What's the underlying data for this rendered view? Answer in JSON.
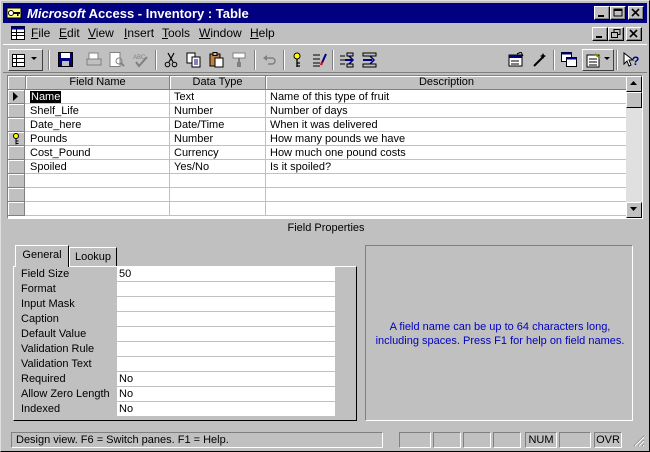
{
  "window": {
    "title_brand": "Microsoft",
    "title_rest": " Access - Inventory : Table"
  },
  "menu": {
    "items": [
      {
        "label": "File",
        "accel": "F"
      },
      {
        "label": "Edit",
        "accel": "E"
      },
      {
        "label": "View",
        "accel": "V"
      },
      {
        "label": "Insert",
        "accel": "I"
      },
      {
        "label": "Tools",
        "accel": "T"
      },
      {
        "label": "Window",
        "accel": "W"
      },
      {
        "label": "Help",
        "accel": "H"
      }
    ]
  },
  "grid": {
    "headers": {
      "field_name": "Field Name",
      "data_type": "Data Type",
      "description": "Description"
    },
    "rows": [
      {
        "field_name": "Name",
        "data_type": "Text",
        "description": "Name of this type of fruit",
        "current": true,
        "key": false
      },
      {
        "field_name": "Shelf_Life",
        "data_type": "Number",
        "description": "Number of days",
        "current": false,
        "key": false
      },
      {
        "field_name": "Date_here",
        "data_type": "Date/Time",
        "description": "When it was delivered",
        "current": false,
        "key": false
      },
      {
        "field_name": "Pounds",
        "data_type": "Number",
        "description": "How many pounds we have",
        "current": false,
        "key": true
      },
      {
        "field_name": "Cost_Pound",
        "data_type": "Currency",
        "description": "How much one pound costs",
        "current": false,
        "key": false
      },
      {
        "field_name": "Spoiled",
        "data_type": "Yes/No",
        "description": "Is it spoiled?",
        "current": false,
        "key": false
      }
    ]
  },
  "field_properties": {
    "section_label": "Field Properties",
    "tabs": [
      "General",
      "Lookup"
    ],
    "active_tab": "General",
    "properties": [
      {
        "label": "Field Size",
        "value": "50"
      },
      {
        "label": "Format",
        "value": ""
      },
      {
        "label": "Input Mask",
        "value": ""
      },
      {
        "label": "Caption",
        "value": ""
      },
      {
        "label": "Default Value",
        "value": ""
      },
      {
        "label": "Validation Rule",
        "value": ""
      },
      {
        "label": "Validation Text",
        "value": ""
      },
      {
        "label": "Required",
        "value": "No"
      },
      {
        "label": "Allow Zero Length",
        "value": "No"
      },
      {
        "label": "Indexed",
        "value": "No"
      }
    ],
    "help_text": "A field name can be up to 64 characters long, including spaces.  Press F1 for help on field names."
  },
  "statusbar": {
    "message": "Design view.  F6 = Switch panes.  F1 = Help.",
    "num": "NUM",
    "ovr": "OVR"
  },
  "colors": {
    "titlebar": "#000080",
    "help_text": "#0000c0",
    "face": "#c0c0c0"
  }
}
